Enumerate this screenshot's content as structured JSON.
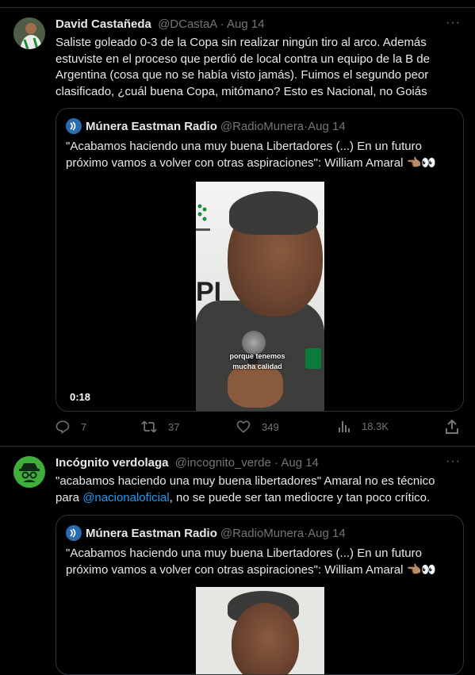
{
  "tweets": [
    {
      "author": {
        "name": "David Castañeda",
        "handle": "@DCastaA",
        "time": "Aug 14"
      },
      "text": "Saliste goleado 0-3 de la Copa sin realizar ningún tiro al arco. Además estuviste en el proceso que perdió de local contra un equipo de la B de Argentina (cosa que no se había visto jamás). Fuimos el segundo peor clasificado, ¿cuál buena Copa, mitómano? Esto es Nacional, no Goiás",
      "text_lines": [
        "Saliste goleado 0-3 de la Copa sin realizar ningún tiro al arco. Además",
        "estuviste en el proceso que perdió de local contra un equipo de la B de",
        "Argentina (cosa que no se había visto jamás). Fuimos el segundo peor",
        "clasificado, ¿cuál buena Copa, mitómano? Esto es Nacional, no Goiás"
      ],
      "quote": {
        "author": {
          "name": "Múnera Eastman Radio",
          "handle": "@RadioMunera",
          "time": "Aug 14"
        },
        "text_lines": [
          "\"Acabamos haciendo una muy buena Libertadores (...) En un futuro",
          "próximo vamos a volver con otras aspiraciones\": William Amaral 👈🏽👀"
        ],
        "video": {
          "caption_line1": "porque tenemos",
          "caption_line2": "mucha calidad",
          "duration": "0:18",
          "bg_text": "PI"
        }
      },
      "actions": {
        "replies": "7",
        "retweets": "37",
        "likes": "349",
        "views": "18.3K"
      }
    },
    {
      "author": {
        "name": "Incógnito verdolaga",
        "handle": "@incognito_verde",
        "time": "Aug 14"
      },
      "text_line1": "\"acabamos haciendo una muy buena libertadores\" Amaral no es técnico",
      "text_line2_pre": "para ",
      "mention": "@nacionaloficial",
      "text_line2_post": ", no se puede ser tan mediocre y tan poco crítico.",
      "quote": {
        "author": {
          "name": "Múnera Eastman Radio",
          "handle": "@RadioMunera",
          "time": "Aug 14"
        },
        "text_lines": [
          "\"Acabamos haciendo una muy buena Libertadores (...) En un futuro",
          "próximo vamos a volver con otras aspiraciones\": William Amaral 👈🏽👀"
        ]
      }
    }
  ],
  "separator": " · ",
  "more_glyph": "···",
  "colors": {
    "background": "#000000",
    "text": "#e7e9ea",
    "muted": "#71767b",
    "link": "#1d9bf0",
    "border": "#2f3336",
    "avatar2": "#3fae3a"
  },
  "icons": [
    "reply-icon",
    "retweet-icon",
    "like-icon",
    "views-icon",
    "share-icon",
    "more-icon",
    "incognito-icon"
  ]
}
